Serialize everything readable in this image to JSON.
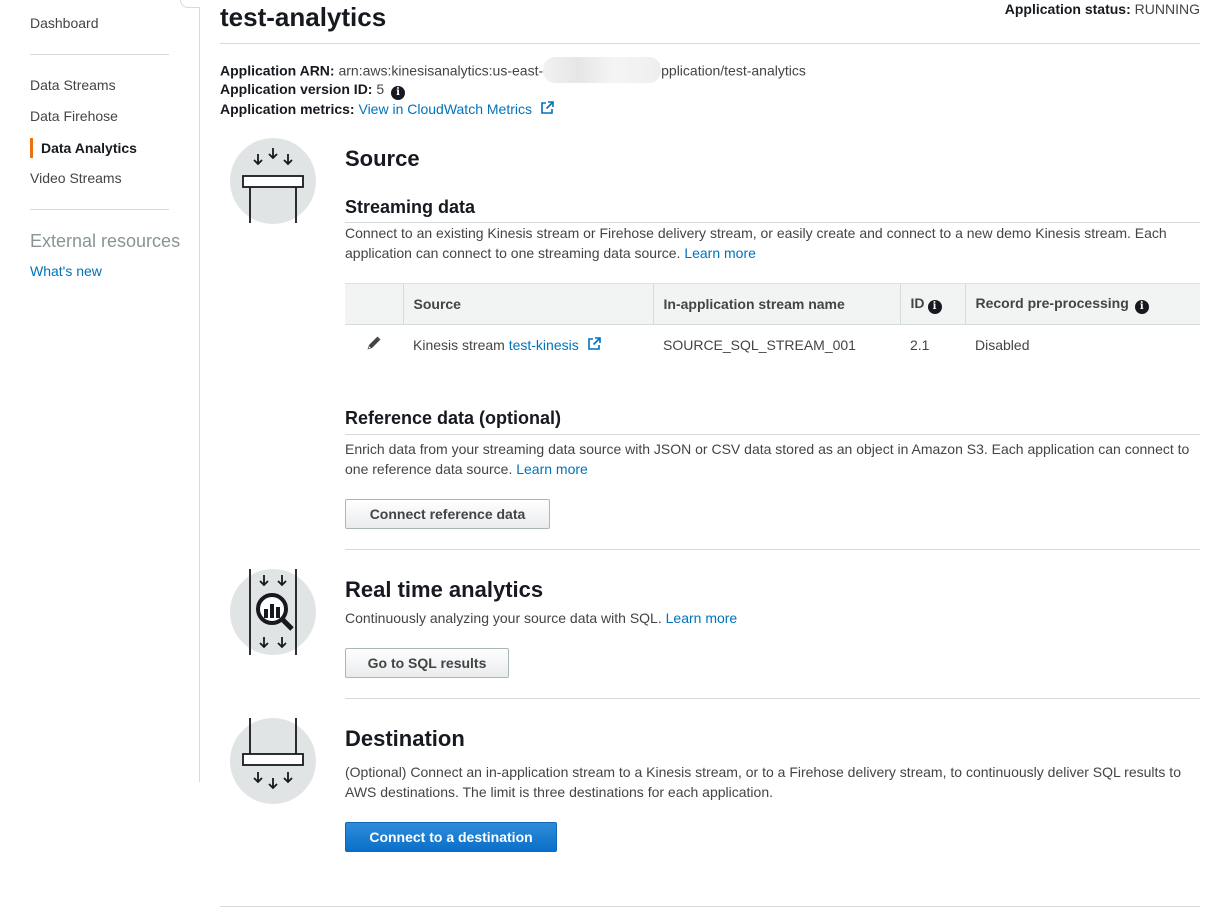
{
  "sidebar": {
    "items": [
      {
        "label": "Dashboard"
      },
      {
        "label": "Data Streams"
      },
      {
        "label": "Data Firehose"
      },
      {
        "label": "Data Analytics",
        "active": true
      },
      {
        "label": "Video Streams"
      }
    ],
    "external_heading": "External resources",
    "whats_new": "What's new"
  },
  "header": {
    "title": "test-analytics",
    "status_label": "Application status:",
    "status_value": "RUNNING"
  },
  "meta": {
    "arn_label": "Application ARN:",
    "arn_prefix": "arn:aws:kinesisanalytics:us-east-",
    "arn_suffix": "pplication/test-analytics",
    "version_label": "Application version ID:",
    "version_value": "5",
    "metrics_label": "Application metrics:",
    "metrics_link": "View in CloudWatch Metrics"
  },
  "source": {
    "title": "Source",
    "streaming_title": "Streaming data",
    "streaming_desc": "Connect to an existing Kinesis stream or Firehose delivery stream, or easily create and connect to a new demo Kinesis stream. Each application can connect to one streaming data source.",
    "learn_more": "Learn more",
    "table": {
      "headers": [
        "Source",
        "In-application stream name",
        "ID",
        "Record pre-processing"
      ],
      "row": {
        "source_prefix": "Kinesis stream",
        "source_link": "test-kinesis",
        "stream_name": "SOURCE_SQL_STREAM_001",
        "id": "2.1",
        "preprocessing": "Disabled"
      }
    },
    "reference_title": "Reference data (optional)",
    "reference_desc": "Enrich data from your streaming data source with JSON or CSV data stored as an object in Amazon S3. Each application can connect to one reference data source.",
    "reference_button": "Connect reference data"
  },
  "analytics": {
    "title": "Real time analytics",
    "desc": "Continuously analyzing your source data with SQL.",
    "learn_more": "Learn more",
    "button": "Go to SQL results"
  },
  "destination": {
    "title": "Destination",
    "desc": "(Optional) Connect an in-application stream to a Kinesis stream, or to a Firehose delivery stream, to continuously deliver SQL results to AWS destinations. The limit is three destinations for each application.",
    "button": "Connect to a destination"
  },
  "colors": {
    "accent": "#ec7211",
    "link": "#0073bb",
    "primary_button": "#0a6fc9"
  }
}
